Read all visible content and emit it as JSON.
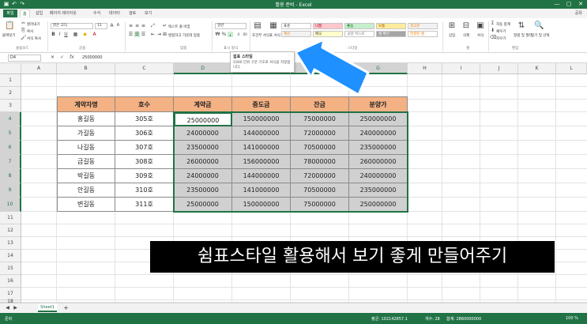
{
  "window": {
    "title": "활용 준비 - Excel",
    "minimize": "—",
    "restore": "▢",
    "close": "✕"
  },
  "tabs": [
    "파일",
    "홈",
    "삽입",
    "페이지 레이아웃",
    "수식",
    "데이터",
    "검토",
    "보기"
  ],
  "share_label": "공유",
  "ribbon": {
    "paste_label": "붙여넣기",
    "cut": "잘라내기",
    "copy": "복사",
    "format_painter": "서식 복사",
    "clipboard_group": "클립보드",
    "font_name": "맑은 고딕",
    "font_size": "11",
    "font_group": "글꼴",
    "wrap_text": "텍스트 줄 바꿈",
    "merge_center": "병합하고 가운데 맞춤",
    "align_group": "맞춤",
    "number_format": "일반",
    "number_group": "표시 형식",
    "cond_format": "조건부 서식",
    "table_format": "표 서식",
    "styles": {
      "normal": "표준",
      "bad": "나쁨",
      "good": "좋음",
      "neutral": "보통",
      "calc": "계산",
      "check": "메모",
      "explain": "설명 텍스트",
      "linked": "셀 확인",
      "warning": "경고문",
      "linked_cell": "연결된 셀"
    },
    "styles_group": "스타일",
    "insert": "삽입",
    "delete": "삭제",
    "format": "서식",
    "cells_group": "셀",
    "autosum": "자동 합계",
    "fill": "채우기",
    "clear": "지우기",
    "sort_filter": "정렬 및 필터",
    "find_select": "찾기 및 선택",
    "edit_group": "편집"
  },
  "tooltip": {
    "title": "쉼표 스타일",
    "body": "1000 단위 구분 기호로 서식을 지정합니다."
  },
  "formula_bar": {
    "name_box": "D4",
    "fx": "fx",
    "value": "25000000"
  },
  "columns": [
    "A",
    "B",
    "C",
    "D",
    "E",
    "F",
    "G",
    "H",
    "I",
    "J",
    "K",
    "L"
  ],
  "rows": [
    "1",
    "2",
    "3",
    "4",
    "5",
    "6",
    "7",
    "8",
    "9",
    "10",
    "11",
    "12",
    "13",
    "14",
    "15",
    "16",
    "17",
    "18",
    "19"
  ],
  "table": {
    "headers": [
      "계약자명",
      "호수",
      "계약금",
      "중도금",
      "잔금",
      "분양가"
    ],
    "rows": [
      [
        "홍길동",
        "305호",
        "25000000",
        "150000000",
        "75000000",
        "250000000"
      ],
      [
        "가길동",
        "306호",
        "24000000",
        "144000000",
        "72000000",
        "240000000"
      ],
      [
        "나길동",
        "307호",
        "23500000",
        "141000000",
        "70500000",
        "235000000"
      ],
      [
        "금길동",
        "308호",
        "26000000",
        "156000000",
        "78000000",
        "260000000"
      ],
      [
        "박길동",
        "309호",
        "24000000",
        "144000000",
        "72000000",
        "240000000"
      ],
      [
        "안길동",
        "310호",
        "23500000",
        "141000000",
        "70500000",
        "235000000"
      ],
      [
        "변길동",
        "311호",
        "25000000",
        "150000000",
        "75000000",
        "250000000"
      ]
    ]
  },
  "caption": "쉼표스타일 활용해서 보기 좋게 만들어주기",
  "sheet_tab": "Sheet1",
  "add_sheet": "+",
  "status": {
    "ready": "준비",
    "average": "평균: 102142857.1",
    "count": "개수: 28",
    "sum": "합계: 2860000000",
    "zoom": "100 %"
  },
  "colors": {
    "excel_green": "#217346",
    "header_orange": "#f4b183",
    "cell_gray": "#d0d0d0",
    "arrow_blue": "#1e90ff"
  }
}
